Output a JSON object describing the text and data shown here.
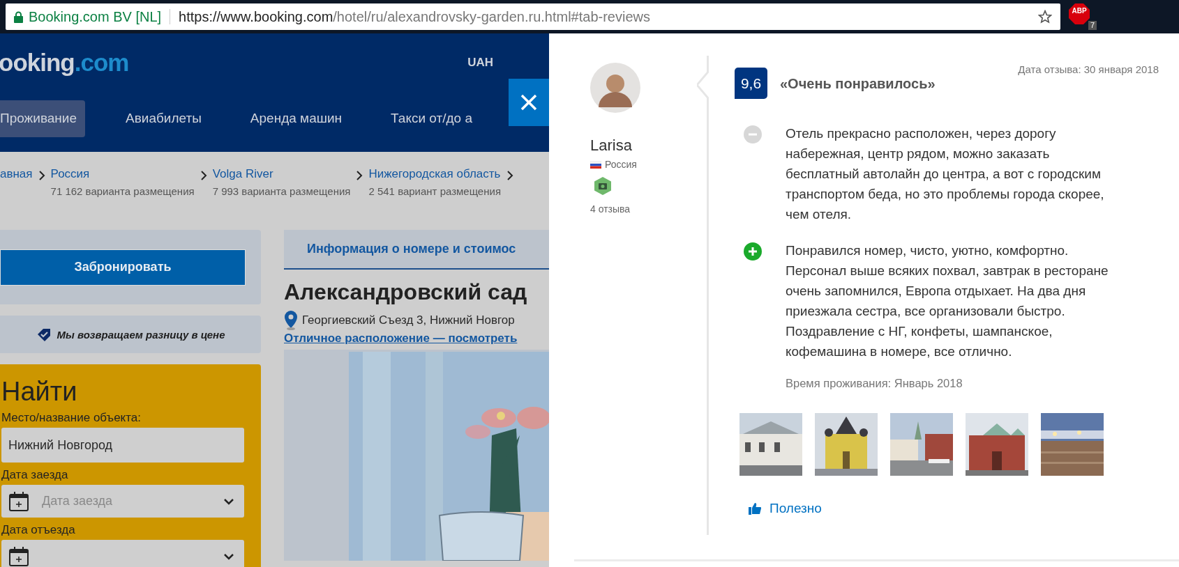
{
  "browser": {
    "site_identity": "Booking.com BV [NL]",
    "url_host": "https://www.booking.com",
    "url_path": "/hotel/ru/alexandrovsky-garden.ru.html#tab-reviews",
    "extension": {
      "label": "ABP",
      "badge": "7"
    }
  },
  "site": {
    "logo": {
      "name": "ooking",
      "tld": ".com"
    },
    "currency": "UAH",
    "nav": [
      {
        "label": "Проживание",
        "selected": true
      },
      {
        "label": "Авиабилеты",
        "selected": false
      },
      {
        "label": "Аренда машин",
        "selected": false
      },
      {
        "label": "Такси от/до а",
        "selected": false
      }
    ],
    "breadcrumbs": [
      {
        "label": "авная"
      },
      {
        "label": "Россия",
        "count": "71 162 варианта размещения"
      },
      {
        "label": "Volga River",
        "count": "7 993 варианта размещения"
      },
      {
        "label": "Нижегородская область",
        "count": "2 541 вариант размещения"
      }
    ],
    "book_button": "Забронировать",
    "price_guarantee": "Мы возвращаем разницу в цене",
    "search": {
      "title": "Найти",
      "fields": [
        {
          "kind": "text",
          "label": "Место/название объекта:",
          "value": "Нижний Новгород"
        },
        {
          "kind": "date",
          "label": "Дата заезда",
          "placeholder": "Дата заезда"
        },
        {
          "kind": "date",
          "label": "Дата отъезда"
        }
      ]
    },
    "hotel": {
      "tab": "Информация о номере и стоимос",
      "name": "Александровский сад",
      "address": "Георгиевский Съезд 3, Нижний Новгор",
      "location_link": "Отличное расположение — посмотреть"
    }
  },
  "review": {
    "date": "Дата отзыва: 30 января 2018",
    "reviewer": {
      "name": "Larisa",
      "country": "Россия",
      "reviews_count": "4 отзыва"
    },
    "score": "9,6",
    "title": "«Очень понравилось»",
    "items": [
      {
        "kind": "negative",
        "text": "Отель прекрасно расположен, через дорогу набережная, центр рядом, можно заказать бесплатный автолайн до центра, а вот с городским транспортом беда, но это проблемы города скорее, чем отеля."
      },
      {
        "kind": "positive",
        "text": "Понравился номер, чисто, уютно, комфортно. Персонал выше всяких похвал, завтрак в ресторане очень запомнился, Европа отдыхает. На два дня приезжала сестра, все организовали быстро. Поздравление с НГ, конфеты, шампанское, кофемашина в номере, все отлично."
      }
    ],
    "stay_time": "Время проживания: Январь 2018",
    "helpful": "Полезно"
  }
}
